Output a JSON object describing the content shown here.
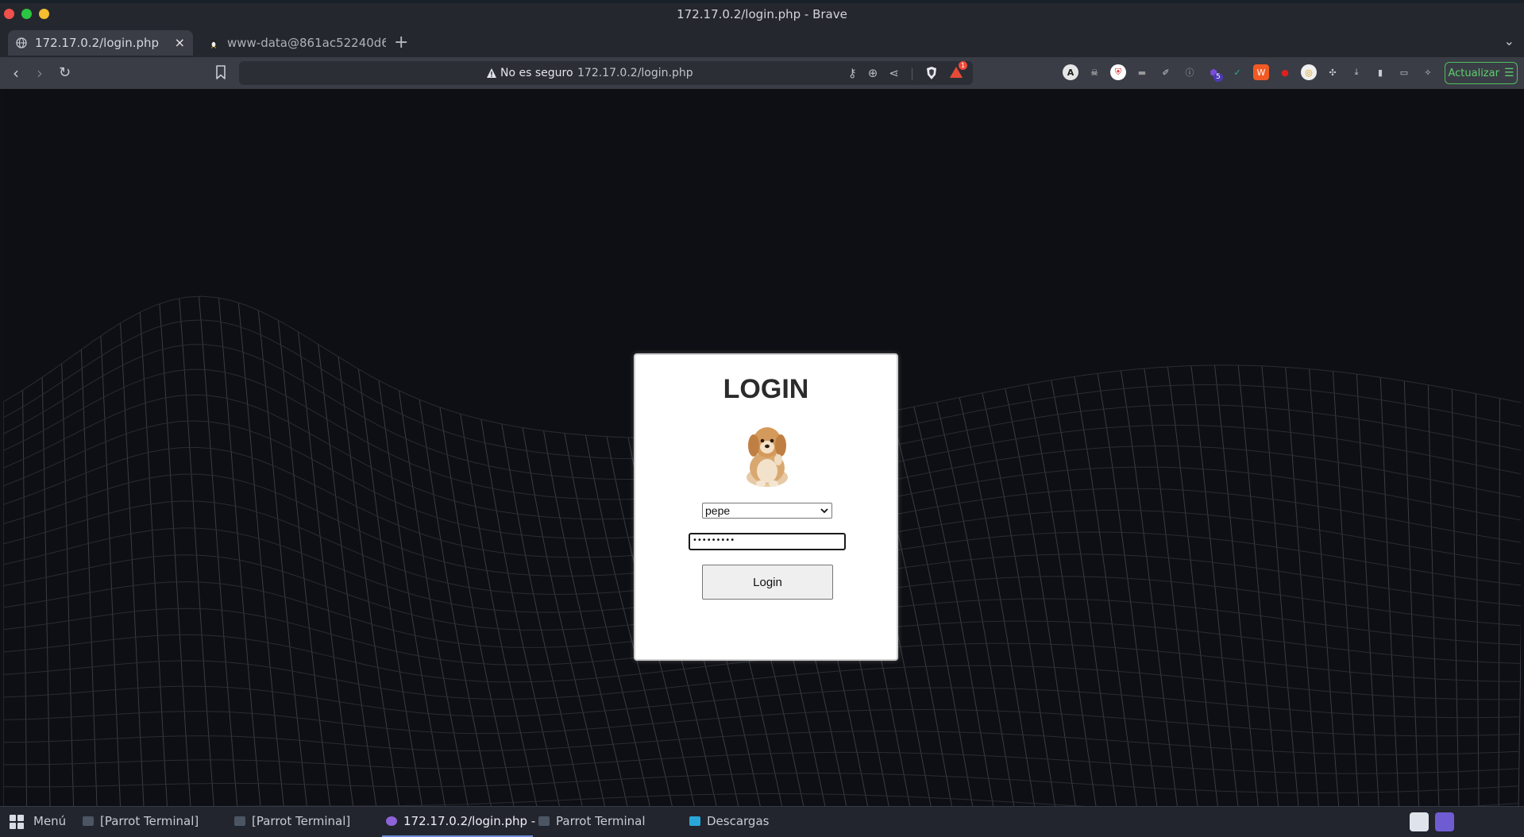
{
  "window": {
    "title": "172.17.0.2/login.php - Brave"
  },
  "tabs": [
    {
      "title": "172.17.0.2/login.php",
      "active": true,
      "close": "×"
    },
    {
      "title": "www-data@861ac52240d6:",
      "active": false
    }
  ],
  "tabbar": {
    "new_tab": "+",
    "tab_menu": "⌄"
  },
  "toolbar": {
    "back": "‹",
    "forward": "›",
    "reload": "↻",
    "security_warning": "No es seguro",
    "url": "172.17.0.2/login.php",
    "notification_badge": "1",
    "extension_badge": "5",
    "update_label": "Actualizar"
  },
  "page": {
    "heading": "LOGIN",
    "user_select": {
      "selected": "pepe"
    },
    "password_value": "•••••••••",
    "login_button": "Login"
  },
  "taskbar": {
    "menu_label": "Menú",
    "items": [
      {
        "label": "[Parrot Terminal]",
        "active": false
      },
      {
        "label": "[Parrot Terminal]",
        "active": false
      },
      {
        "label": "172.17.0.2/login.php - ...",
        "active": true
      },
      {
        "label": "Parrot Terminal",
        "active": false
      },
      {
        "label": "Descargas",
        "active": false
      }
    ]
  },
  "colors": {
    "page_background": "#0e0f14",
    "accent_update": "#4fbd5e",
    "brave_orange": "#fb542b"
  }
}
